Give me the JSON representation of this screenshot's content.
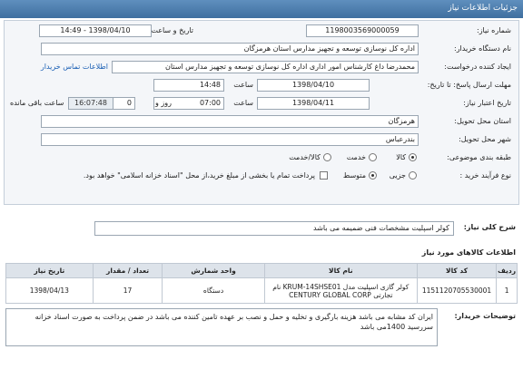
{
  "header": {
    "title": "جزئیات اطلاعات نیاز"
  },
  "form": {
    "need_number_label": "شماره نیاز:",
    "need_number": "1198003569000059",
    "announce_label": "تاریخ و ساعت اعلان عمومی:",
    "announce_value": "1398/04/10 - 14:49",
    "buyer_label": "نام دستگاه خریدار:",
    "buyer_value": "اداره کل نوسازی توسعه و تجهیز مدارس استان هرمزگان",
    "creator_label": "ایجاد کننده درخواست:",
    "creator_value": "محمدرضا داغ کارشناس امور اداری اداره کل نوسازی توسعه و تجهیز مدارس استان",
    "contact_link": "اطلاعات تماس خریدار",
    "send_deadline_label": "مهلت ارسال پاسخ: تا تاریخ:",
    "send_date": "1398/04/10",
    "send_time_label": "ساعت",
    "send_time": "14:48",
    "validity_label": "تاریخ اعتبار نیاز:",
    "validity_date": "1398/04/11",
    "validity_time_label": "ساعت",
    "validity_time": "07:00",
    "days_value": "0",
    "days_label": "روز و",
    "remaining_time": "16:07:48",
    "remaining_label": "ساعت باقی مانده",
    "province_label": "استان محل تحویل:",
    "province_value": "هرمزگان",
    "city_label": "شهر محل تحویل:",
    "city_value": "بندرعباس",
    "category_label": "طبقه بندی موضوعی:",
    "category_options": [
      "کالا",
      "خدمت",
      "کالا/خدمت"
    ],
    "process_label": "نوع فرآیند خرید :",
    "process_options": [
      "جزیی",
      "متوسط"
    ],
    "payment_note": "پرداخت تمام یا بخشی از مبلغ خرید،از محل \"اسناد خزانه اسلامی\" خواهد بود."
  },
  "description": {
    "label": "شرح کلی نیاز:",
    "value": "کولر اسپلیت مشخصات فنی ضمیمه می باشد"
  },
  "goods": {
    "title": "اطلاعات کالاهای مورد نیاز",
    "columns": [
      "ردیف",
      "کد کالا",
      "نام کالا",
      "واحد شمارش",
      "تعداد / مقدار",
      "تاریخ نیاز"
    ],
    "rows": [
      [
        "1",
        "1151120705530001",
        "کولر گازی اسپلیت مدل KRUM-14SHSE01 نام تجارتی CENTURY GLOBAL CORP",
        "دستگاه",
        "17",
        "1398/04/13"
      ]
    ]
  },
  "buyer_notes": {
    "label": "توضیحات خریدار:",
    "value": "ایران کد مشابه می باشد هزینه بارگیری و تخلیه و حمل و نصب بر عهده تامین کننده می باشد در ضمن پرداخت به صورت اسناد خزانه سررسید 1400می باشد"
  }
}
